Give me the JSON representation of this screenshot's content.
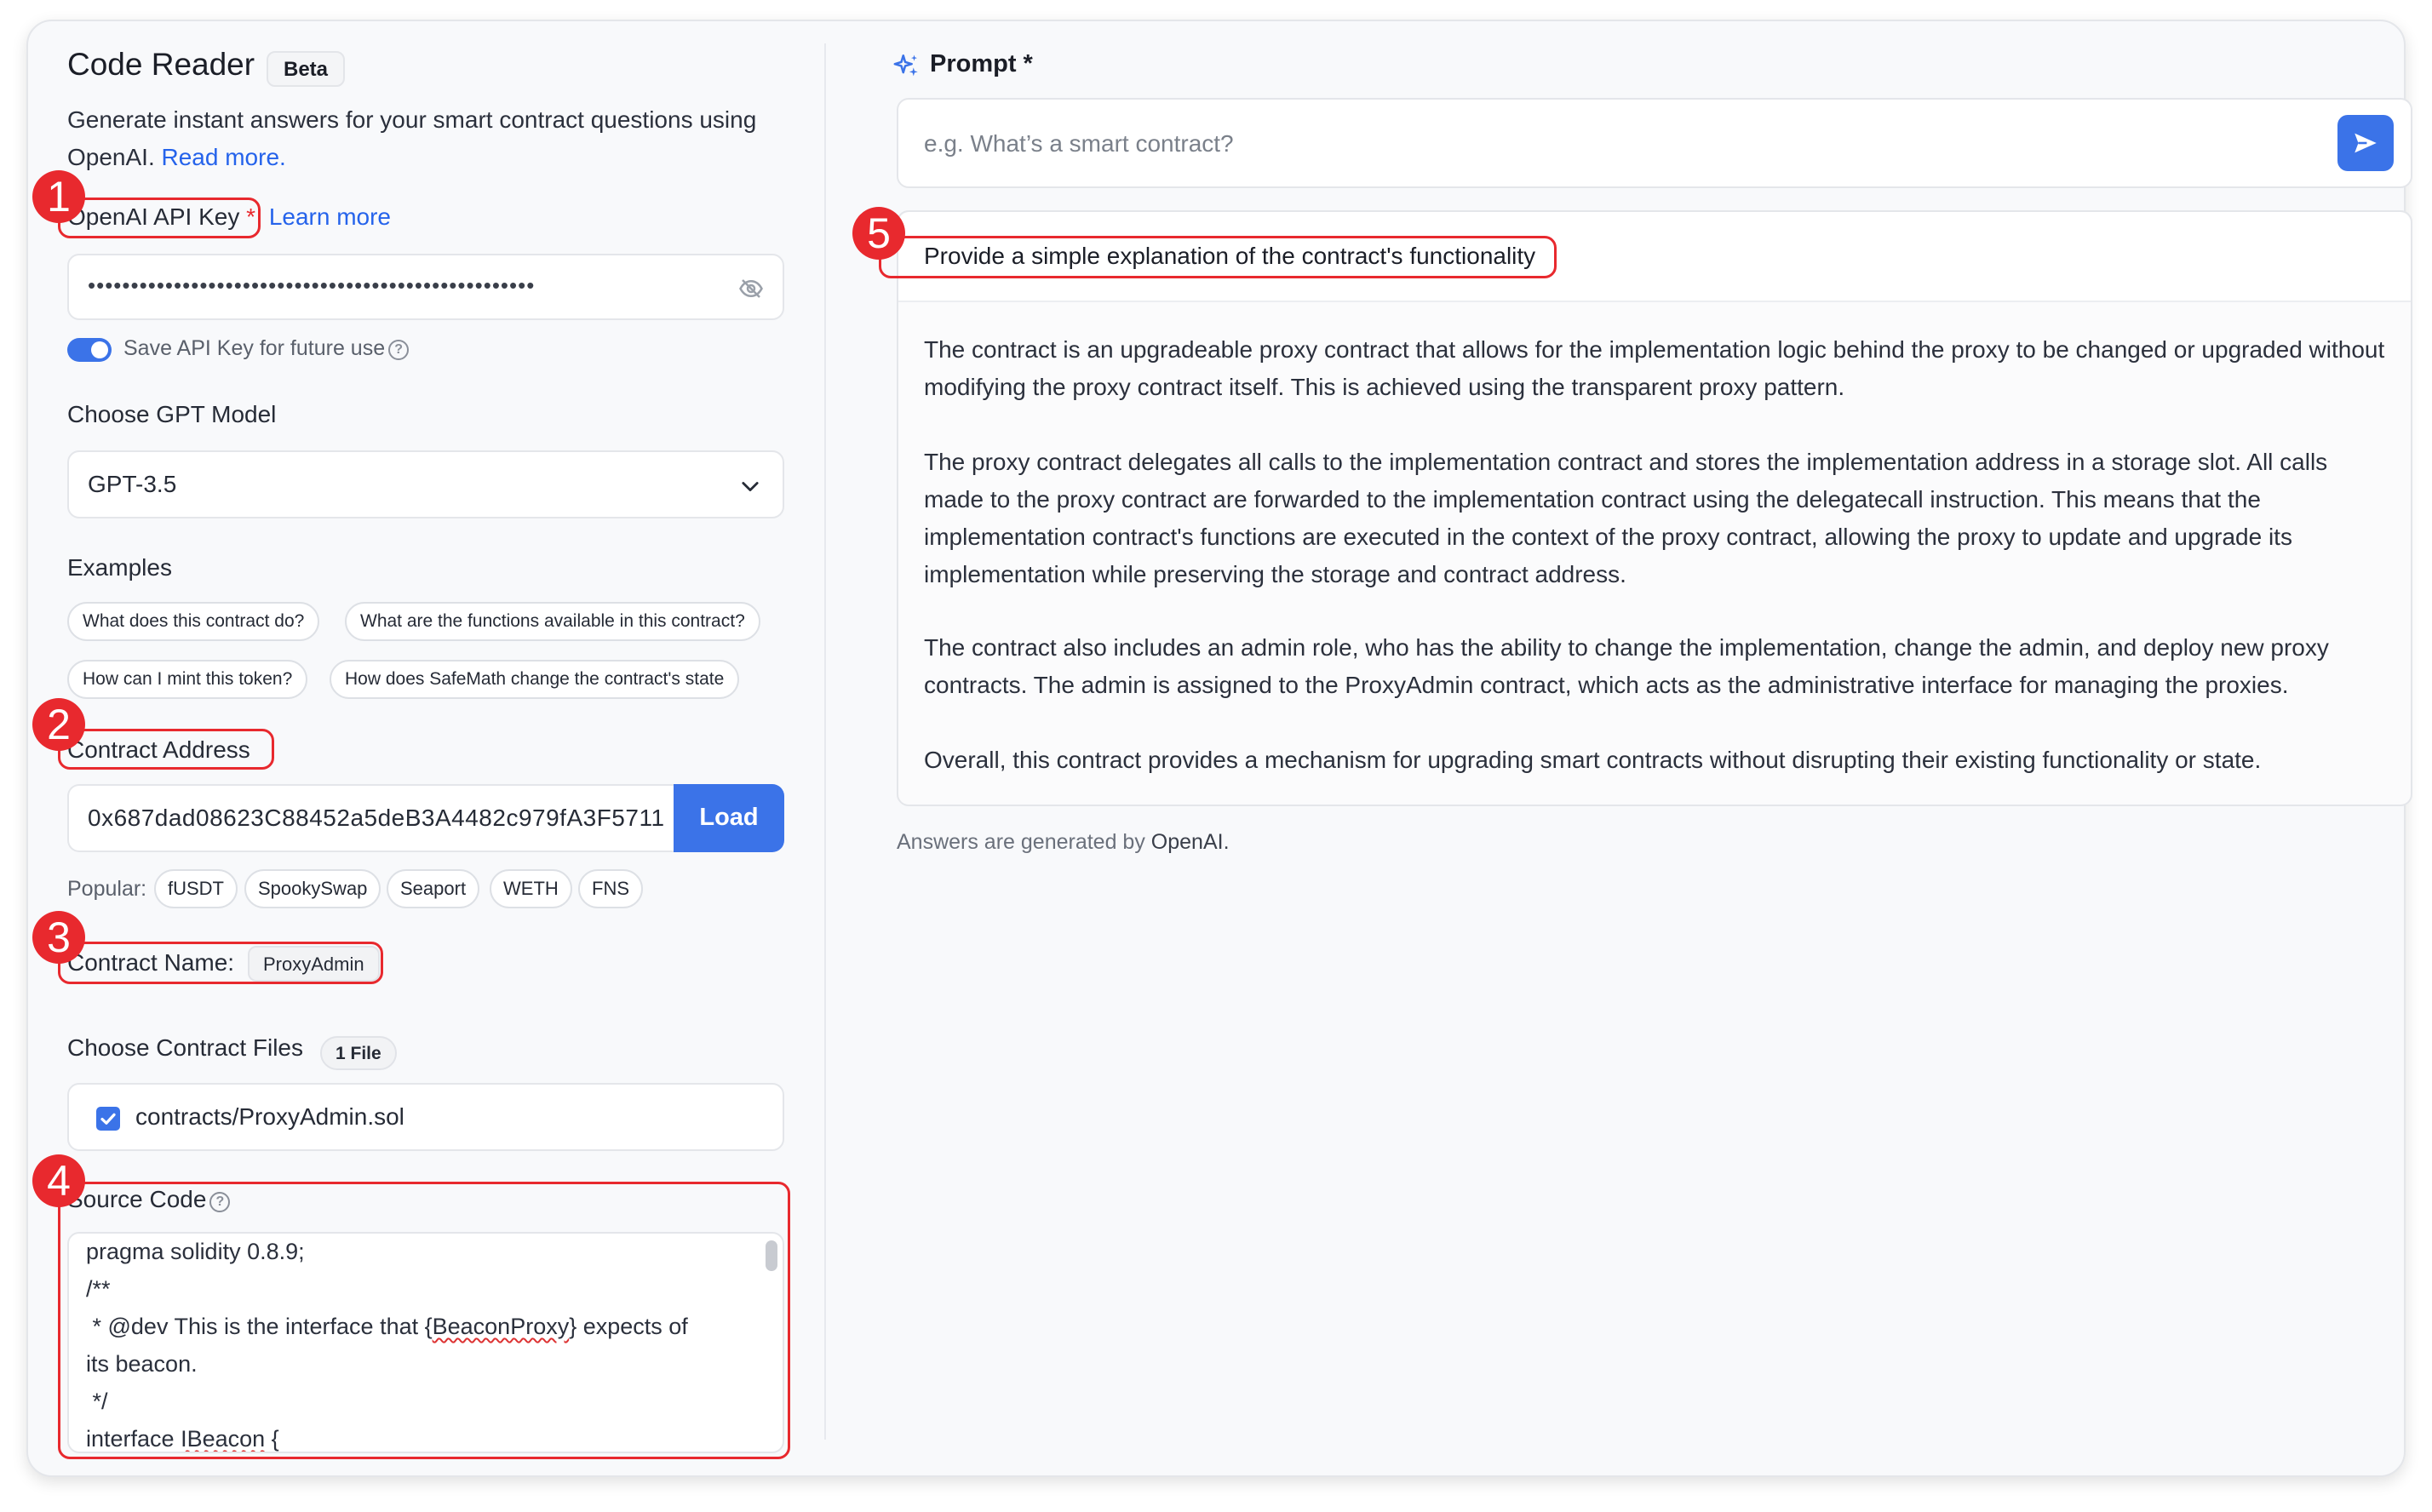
{
  "app": {
    "title": "Code Reader",
    "badge": "Beta",
    "subtitle": "Generate instant answers for your smart contract questions using OpenAI.",
    "read_more": "Read more."
  },
  "api_key": {
    "label": "OpenAI API Key",
    "required_mark": "*",
    "learn_more": "Learn more",
    "value_masked": "••••••••••••••••••••••••••••••••••••••••••••••••••••",
    "save_label": "Save API Key for future use",
    "save_enabled": true,
    "icon": "eye-off-icon"
  },
  "model": {
    "label": "Choose GPT Model",
    "selected": "GPT-3.5"
  },
  "examples": {
    "label": "Examples",
    "items": [
      "What does this contract do?",
      "What are the functions available in this contract?",
      "How can I mint this token?",
      "How does SafeMath change the contract's state"
    ]
  },
  "contract_address": {
    "label": "Contract Address",
    "value": "0x687dad08623C88452a5deB3A4482c979fA3F5711",
    "load_label": "Load",
    "popular_label": "Popular:",
    "popular": [
      "fUSDT",
      "SpookySwap",
      "Seaport",
      "WETH",
      "FNS"
    ]
  },
  "contract_name": {
    "label": "Contract Name:",
    "value": "ProxyAdmin"
  },
  "files": {
    "label": "Choose Contract Files",
    "count": "1 File",
    "items": [
      "contracts/ProxyAdmin.sol"
    ]
  },
  "source_code": {
    "label": "Source Code",
    "lines": [
      "pragma solidity 0.8.9;",
      "/**",
      " * @dev This is the interface that {BeaconProxy} expects of",
      "its beacon.",
      " */",
      "interface IBeacon {"
    ]
  },
  "prompt": {
    "label": "Prompt *",
    "placeholder": "e.g. What’s a smart contract?"
  },
  "answer": {
    "question": "Provide a simple explanation of the contract's functionality",
    "paragraphs": [
      "The contract is an upgradeable proxy contract that allows for the implementation logic behind the proxy to be changed or upgraded without modifying the proxy contract itself. This is achieved using the transparent proxy pattern.",
      "The proxy contract delegates all calls to the implementation contract and stores the implementation address in a storage slot. All calls made to the proxy contract are forwarded to the implementation contract using the delegatecall instruction. This means that the implementation contract's functions are executed in the context of the proxy contract, allowing the proxy to update and upgrade its implementation while preserving the storage and contract address.",
      "The contract also includes an admin role, who has the ability to change the implementation, change the admin, and deploy new proxy contracts. The admin is assigned to the ProxyAdmin contract, which acts as the administrative interface for managing the proxies.",
      "Overall, this contract provides a mechanism for upgrading smart contracts without disrupting their existing functionality or state."
    ],
    "footer_prefix": "Answers are generated by",
    "footer_brand": "OpenAI."
  },
  "annotations": [
    "1",
    "2",
    "3",
    "4",
    "5"
  ],
  "colors": {
    "accent": "#3b73e8",
    "highlight": "#e8292e",
    "link": "#2563eb"
  }
}
